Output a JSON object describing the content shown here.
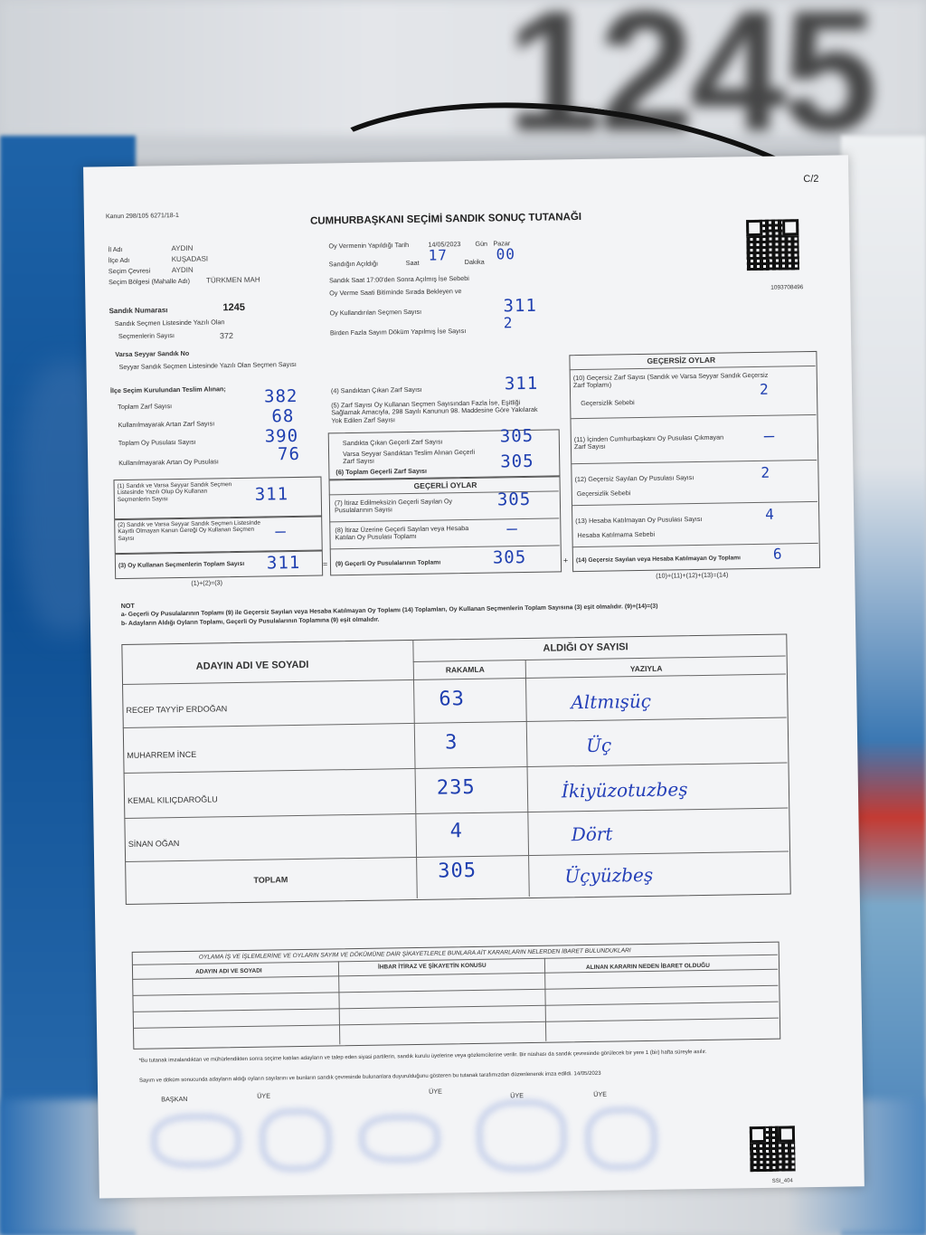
{
  "page_code": "C/2",
  "law_ref": "Kanun 298/105 6271/18-1",
  "title": "CUMHURBAŞKANI SEÇİMİ SANDIK SONUÇ TUTANAĞI",
  "location": {
    "il_label": "İl Adı",
    "il": "AYDIN",
    "ilce_label": "İlçe Adı",
    "ilce": "KUŞADASI",
    "cevre_label": "Seçim Çevresi",
    "cevre": "AYDIN",
    "bolge_label": "Seçim Bölgesi (Mahalle Adı)",
    "bolge": "TÜRKMEN MAH"
  },
  "vote_date_label": "Oy Vermenin Yapıldığı Tarih",
  "vote_date": "14/05/2023",
  "day_label": "Gün",
  "day": "Pazar",
  "opening_label": "Sandığın Açıldığı",
  "hour_label": "Saat",
  "hour": "17",
  "minute_label": "Dakika",
  "minute": "00",
  "line_1700": "Sandık Saat 17:00'den Sonra Açılmış İse Sebebi",
  "line_waiting": "Oy Verme Saati Bitiminde Sırada Bekleyen ve",
  "voters_used_label": "Oy Kullandırılan Seçmen Sayısı",
  "voters_used": "311",
  "multi_count_label": "Birden Fazla Sayım Döküm Yapılmış İse Sayısı",
  "multi_count": "2",
  "barcode_number": "1093708496",
  "box": {
    "number_label": "Sandık Numarası",
    "number": "1245",
    "list_label": "Sandık Seçmen Listesinde Yazılı Olan",
    "list_label2": "Seçmenlerin Sayısı",
    "list_count": "372",
    "mobile_label": "Varsa Seyyar Sandık No",
    "mobile_count_label": "Seyyar Sandık Seçmen Listesinde Yazılı Olan Seçmen Sayısı"
  },
  "received": {
    "header": "İlçe Seçim Kurulundan Teslim Alınan;",
    "envelope_total_label": "Toplam Zarf Sayısı",
    "envelope_total": "382",
    "envelope_unused_label": "Kullanılmayarak Artan Zarf Sayısı",
    "envelope_unused": "68",
    "ballot_total_label": "Toplam Oy Pusulası Sayısı",
    "ballot_total": "390",
    "ballot_unused_label": "Kullanılmayarak Artan Oy Pusulası",
    "ballot_unused": "76"
  },
  "calc": {
    "row1_label": "(1) Sandık ve Varsa Seyyar Sandık Seçmen Listesinde Yazılı Olup Oy Kullanan Seçmenlerin Sayısı",
    "row1": "311",
    "row2_label": "(2) Sandık ve Varsa Seyyar Sandık Seçmen Listesinde Kayıtlı Olmayan Kanun Gereği Oy Kullanan Seçmen Sayısı",
    "row3_label": "(3) Oy Kullanan Seçmenlerin Toplam Sayısı",
    "row3": "311",
    "row3_formula": "(1)+(2)=(3)",
    "row4_label": "(4) Sandıktan Çıkan Zarf Sayısı",
    "row4": "311",
    "row5_label": "(5) Zarf Sayısı Oy Kullanan Seçmen Sayısından Fazla İse, Eşitliği Sağlamak Amacıyla, 298 Sayılı Kanunun 98. Maddesine Göre Yakılarak Yok Edilen Zarf Sayısı",
    "valid_env_label": "Sandıkta Çıkan Geçerli Zarf Sayısı",
    "valid_env": "305",
    "mobile_env_label": "Varsa Seyyar Sandıktan Teslim Alınan Geçerli Zarf Sayısı",
    "row6_label": "(6) Toplam Geçerli Zarf Sayısı",
    "row6": "305"
  },
  "valid_votes": {
    "header": "GEÇERLİ OYLAR",
    "row7_label": "(7) İtiraz Edilmeksizin Geçerli Sayılan Oy Pusulalarının Sayısı",
    "row7": "305",
    "row8_label": "(8) İtiraz Üzerine Geçerli Sayılan veya Hesaba Katılan Oy Pusulası Toplamı",
    "row9_label": "(9) Geçerli Oy Pusulalarının Toplamı",
    "row9": "305"
  },
  "invalid_votes": {
    "header": "GEÇERSİZ OYLAR",
    "row10_label": "(10) Geçersiz Zarf Sayısı (Sandık ve Varsa Seyyar Sandık Geçersiz Zarf Toplamı)",
    "row10": "2",
    "row10_reason": "Geçersizlik Sebebi",
    "row11_label": "(11) İçinden Cumhurbaşkanı Oy Pusulası Çıkmayan Zarf Sayısı",
    "row12_label": "(12) Geçersiz Sayılan Oy Pusulası Sayısı",
    "row12": "2",
    "row12_reason": "Geçersizlik Sebebi",
    "row13_label": "(13) Hesaba Katılmayan Oy Pusulası Sayısı",
    "row13": "4",
    "row13_reason": "Hesaba Katılmama Sebebi",
    "row14_label": "(14) Geçersiz Sayılan veya Hesaba Katılmayan Oy Toplamı",
    "row14": "6",
    "row14_formula": "(10)+(11)+(12)+(13)=(14)"
  },
  "notes": {
    "header": "NOT",
    "a": "a- Geçerli Oy Pusulalarının Toplamı (9) ile Geçersiz Sayılan veya Hesaba Katılmayan Oy Toplamı (14) Toplamları, Oy Kullanan Seçmenlerin Toplam Sayısına (3) eşit olmalıdır. (9)+(14)=(3)",
    "b": "b- Adayların Aldığı Oyların Toplamı, Geçerli Oy Pusulalarının Toplamına (9) eşit olmalıdır."
  },
  "results": {
    "name_header": "ADAYIN ADI VE SOYADI",
    "votes_header": "ALDIĞI OY SAYISI",
    "digits_header": "RAKAMLA",
    "words_header": "YAZIYLA",
    "rows": [
      {
        "name": "RECEP TAYYİP ERDOĞAN",
        "digits": "63",
        "words": "Altmışüç"
      },
      {
        "name": "MUHARREM İNCE",
        "digits": "3",
        "words": "Üç"
      },
      {
        "name": "KEMAL KILIÇDAROĞLU",
        "digits": "235",
        "words": "İkiyüzotuzbeş"
      },
      {
        "name": "SİNAN OĞAN",
        "digits": "4",
        "words": "Dört"
      }
    ],
    "total_label": "TOPLAM",
    "total_digits": "305",
    "total_words": "Üçyüzbeş"
  },
  "complaints": {
    "header": "OYLAMA İŞ VE İŞLEMLERİNE VE OYLARIN SAYIM VE DÖKÜMÜNE DAİR ŞİKAYETLERLE BUNLARA AİT KARARLARIN NELERDEN İBARET BULUNDUKLARI",
    "col1": "ADAYIN ADI VE SOYADI",
    "col2": "İHBAR İTİRAZ VE ŞİKAYETİN KONUSU",
    "col3": "ALINAN KARARIN NEDEN İBARET OLDUĞU"
  },
  "footer": {
    "line1": "*Bu tutanak imzalandıktan ve mühürlendikten sonra seçime katılan adayların ve talep eden siyasi partilerin, sandık kurulu üyelerine veya gözlemcilerine verilir. Bir nüshası da sandık çevresinde görülecek bir yere 1 (bir) hafta süreyle asılır.",
    "line2": "Sayım ve döküm sonucunda adayların aldığı oyların sayılarını ve bunların sandık çevresinde bulunanlara duyurulduğunu gösteren bu tutanak tarafımızdan düzenlenerek imza edildi. 14/05/2023",
    "sign_chair": "BAŞKAN",
    "sign_member": "ÜYE"
  },
  "bottom_code": "SSI_404"
}
